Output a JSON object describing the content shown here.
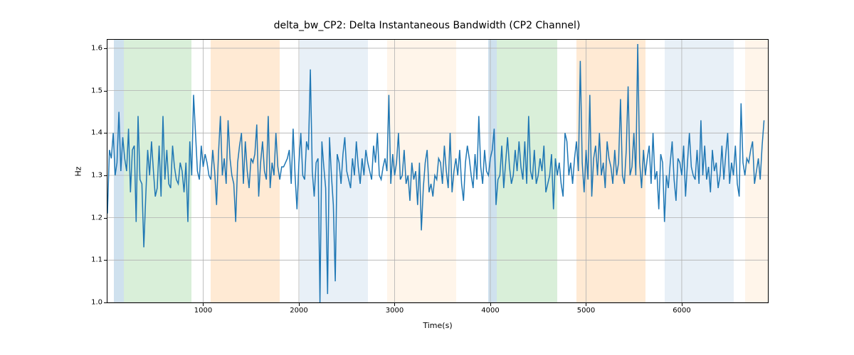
{
  "chart_data": {
    "type": "line",
    "title": "delta_bw_CP2: Delta Instantaneous Bandwidth (CP2 Channel)",
    "xlabel": "Time(s)",
    "ylabel": "Hz",
    "xlim": [
      0,
      6900
    ],
    "ylim": [
      1.0,
      1.62
    ],
    "xticks": [
      1000,
      2000,
      3000,
      4000,
      5000,
      6000
    ],
    "yticks": [
      1.0,
      1.1,
      1.2,
      1.3,
      1.4,
      1.5,
      1.6
    ],
    "line_color": "#1f77b4",
    "bands": [
      {
        "start": 70,
        "end": 170,
        "color": "#a8c8e0",
        "opacity": 0.55
      },
      {
        "start": 170,
        "end": 880,
        "color": "#b9e2b9",
        "opacity": 0.55
      },
      {
        "start": 1080,
        "end": 1800,
        "color": "#ffd8b1",
        "opacity": 0.55
      },
      {
        "start": 2010,
        "end": 2720,
        "color": "#d6e4f0",
        "opacity": 0.55
      },
      {
        "start": 2920,
        "end": 3640,
        "color": "#ffe9d1",
        "opacity": 0.45
      },
      {
        "start": 3980,
        "end": 4070,
        "color": "#a8c8e0",
        "opacity": 0.55
      },
      {
        "start": 4070,
        "end": 4700,
        "color": "#b9e2b9",
        "opacity": 0.55
      },
      {
        "start": 4900,
        "end": 5620,
        "color": "#ffd8b1",
        "opacity": 0.55
      },
      {
        "start": 5820,
        "end": 6540,
        "color": "#d6e4f0",
        "opacity": 0.55
      },
      {
        "start": 6660,
        "end": 6900,
        "color": "#ffe9d1",
        "opacity": 0.45
      }
    ],
    "x_interval": 20,
    "values": [
      1.21,
      1.36,
      1.34,
      1.4,
      1.3,
      1.33,
      1.45,
      1.31,
      1.39,
      1.34,
      1.31,
      1.41,
      1.26,
      1.36,
      1.37,
      1.19,
      1.44,
      1.29,
      1.28,
      1.13,
      1.25,
      1.36,
      1.3,
      1.38,
      1.31,
      1.25,
      1.27,
      1.37,
      1.25,
      1.44,
      1.29,
      1.36,
      1.28,
      1.27,
      1.37,
      1.32,
      1.29,
      1.28,
      1.33,
      1.31,
      1.26,
      1.33,
      1.19,
      1.38,
      1.3,
      1.49,
      1.4,
      1.31,
      1.29,
      1.37,
      1.32,
      1.35,
      1.33,
      1.3,
      1.29,
      1.36,
      1.31,
      1.23,
      1.35,
      1.44,
      1.3,
      1.34,
      1.28,
      1.43,
      1.34,
      1.3,
      1.28,
      1.19,
      1.33,
      1.37,
      1.4,
      1.28,
      1.38,
      1.31,
      1.27,
      1.34,
      1.33,
      1.35,
      1.42,
      1.25,
      1.33,
      1.38,
      1.31,
      1.29,
      1.44,
      1.27,
      1.33,
      1.3,
      1.4,
      1.32,
      1.29,
      1.32,
      1.32,
      1.33,
      1.34,
      1.36,
      1.28,
      1.41,
      1.3,
      1.22,
      1.33,
      1.4,
      1.3,
      1.29,
      1.38,
      1.36,
      1.55,
      1.31,
      1.25,
      1.33,
      1.34,
      1.0,
      1.38,
      1.32,
      1.27,
      1.02,
      1.39,
      1.3,
      1.23,
      1.05,
      1.35,
      1.33,
      1.28,
      1.35,
      1.39,
      1.31,
      1.29,
      1.27,
      1.34,
      1.3,
      1.38,
      1.32,
      1.28,
      1.34,
      1.3,
      1.36,
      1.33,
      1.31,
      1.29,
      1.37,
      1.33,
      1.4,
      1.3,
      1.29,
      1.32,
      1.34,
      1.31,
      1.49,
      1.28,
      1.35,
      1.3,
      1.33,
      1.4,
      1.29,
      1.3,
      1.36,
      1.28,
      1.3,
      1.24,
      1.33,
      1.29,
      1.31,
      1.23,
      1.33,
      1.17,
      1.27,
      1.33,
      1.36,
      1.26,
      1.28,
      1.25,
      1.3,
      1.29,
      1.34,
      1.33,
      1.28,
      1.37,
      1.31,
      1.27,
      1.4,
      1.26,
      1.31,
      1.34,
      1.3,
      1.36,
      1.28,
      1.24,
      1.33,
      1.37,
      1.34,
      1.3,
      1.27,
      1.35,
      1.29,
      1.44,
      1.32,
      1.28,
      1.36,
      1.31,
      1.3,
      1.34,
      1.36,
      1.41,
      1.23,
      1.29,
      1.3,
      1.37,
      1.27,
      1.33,
      1.39,
      1.32,
      1.28,
      1.3,
      1.36,
      1.31,
      1.38,
      1.32,
      1.29,
      1.38,
      1.28,
      1.44,
      1.31,
      1.29,
      1.36,
      1.28,
      1.3,
      1.34,
      1.31,
      1.37,
      1.26,
      1.28,
      1.3,
      1.35,
      1.22,
      1.34,
      1.3,
      1.33,
      1.28,
      1.25,
      1.4,
      1.38,
      1.3,
      1.33,
      1.28,
      1.34,
      1.38,
      1.31,
      1.57,
      1.33,
      1.26,
      1.36,
      1.29,
      1.49,
      1.25,
      1.34,
      1.37,
      1.3,
      1.4,
      1.3,
      1.33,
      1.27,
      1.38,
      1.34,
      1.32,
      1.28,
      1.36,
      1.3,
      1.33,
      1.48,
      1.3,
      1.28,
      1.36,
      1.51,
      1.3,
      1.32,
      1.4,
      1.3,
      1.61,
      1.33,
      1.27,
      1.36,
      1.3,
      1.34,
      1.37,
      1.28,
      1.4,
      1.29,
      1.31,
      1.22,
      1.35,
      1.33,
      1.19,
      1.3,
      1.27,
      1.33,
      1.38,
      1.29,
      1.24,
      1.34,
      1.33,
      1.3,
      1.37,
      1.25,
      1.33,
      1.4,
      1.32,
      1.3,
      1.29,
      1.36,
      1.28,
      1.43,
      1.3,
      1.37,
      1.29,
      1.32,
      1.26,
      1.36,
      1.31,
      1.33,
      1.27,
      1.3,
      1.37,
      1.29,
      1.35,
      1.4,
      1.28,
      1.33,
      1.3,
      1.37,
      1.28,
      1.25,
      1.47,
      1.33,
      1.3,
      1.34,
      1.33,
      1.36,
      1.38,
      1.28,
      1.31,
      1.34,
      1.29,
      1.37,
      1.43
    ]
  }
}
